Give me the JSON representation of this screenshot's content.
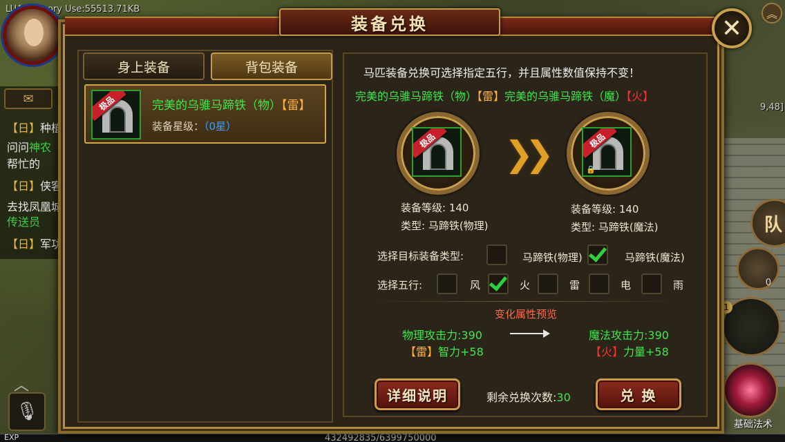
{
  "hud": {
    "memory_label": "LUA Memory Use:55513.71KB",
    "chat_tab_icon": "map-icon",
    "chat_lines": [
      {
        "tag": "【日】",
        "text": "种植"
      },
      {
        "tag": "",
        "text": "问问",
        "npc": "神农"
      },
      {
        "tag": "",
        "text": "帮忙的"
      },
      {
        "tag": "【日】",
        "text": "侠客"
      },
      {
        "tag": "",
        "text": "去找凤凰城"
      },
      {
        "tag": "",
        "text": "",
        "npc": "传送员"
      },
      {
        "tag": "【日】",
        "text": "军功"
      }
    ],
    "exp_label": "EXP",
    "exp_value": "432492835/6399750000",
    "team_label": "队",
    "bag_count": "0",
    "slot_num": "1",
    "skill_label": "基础法术",
    "minimap_coords": "9,48]"
  },
  "dialog": {
    "title": "装备兑换",
    "close_icon": "close-icon",
    "tabs": [
      {
        "label": "身上装备",
        "active": false
      },
      {
        "label": "背包装备",
        "active": true
      }
    ],
    "item": {
      "badge": "极品",
      "name_prefix": "完美的乌骓马蹄铁（物）",
      "name_element": "【雷】",
      "star_label": "装备星级：",
      "star_value": "（0星）"
    },
    "notice": "马匹装备兑换可选择指定五行，并且属性数值保持不变！",
    "conversion": {
      "from_name": "完美的乌骓马蹄铁（物）",
      "from_element": "【雷】",
      "to_name": "完美的乌骓马蹄铁（魔）",
      "to_element": "【火】"
    },
    "source": {
      "badge": "极品",
      "level_label": "装备等级: 140",
      "type_label": "类型: 马蹄铁(物理)"
    },
    "target": {
      "badge": "极品",
      "level_label": "装备等级: 140",
      "type_label": "类型: 马蹄铁(魔法)"
    },
    "type_select": {
      "label": "选择目标装备类型:",
      "options": [
        {
          "label": "马蹄铁(物理)",
          "checked": false
        },
        {
          "label": "马蹄铁(魔法)",
          "checked": true
        }
      ]
    },
    "element_select": {
      "label": "选择五行:",
      "options": [
        {
          "label": "风",
          "checked": false
        },
        {
          "label": "火",
          "checked": true
        },
        {
          "label": "雷",
          "checked": false
        },
        {
          "label": "电",
          "checked": false
        },
        {
          "label": "雨",
          "checked": false
        }
      ]
    },
    "preview": {
      "title": "变化属性预览",
      "from_attack": "物理攻击力:390",
      "from_bonus_element": "【雷】",
      "from_bonus": "智力+58",
      "to_attack": "魔法攻击力:390",
      "to_bonus_element": "【火】",
      "to_bonus": "力量+58"
    },
    "detail_button": "详细说明",
    "remaining_label": "剩余兑换次数:",
    "remaining_value": "30",
    "exchange_button": "兑 换"
  }
}
